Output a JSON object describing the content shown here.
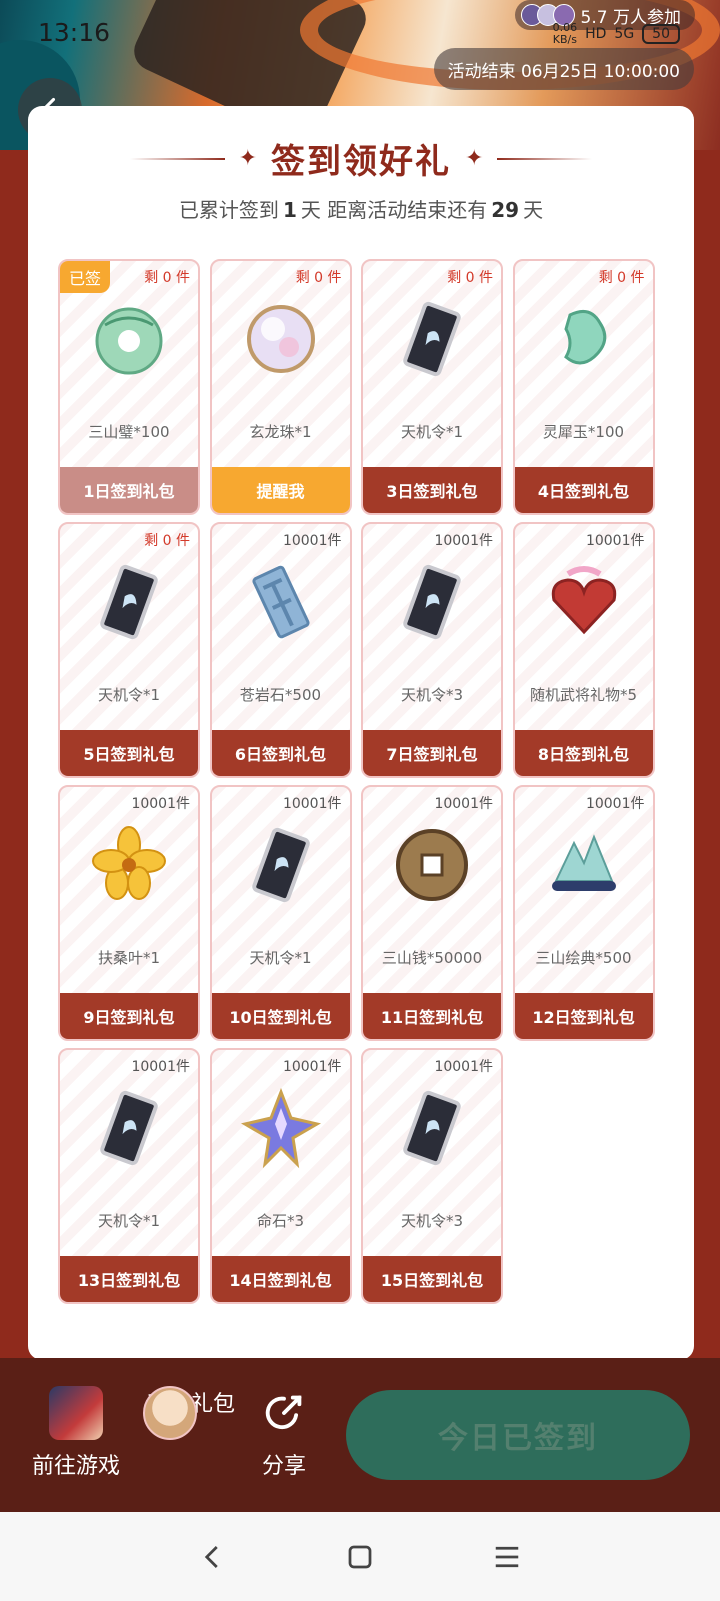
{
  "status_bar": {
    "time": "13:16",
    "net_speed": "0.06",
    "net_unit": "KB/s",
    "hd": "HD",
    "signal": "5G",
    "battery": "50"
  },
  "header": {
    "participants": "5.7 万人参加",
    "end_time": "活动结束 06月25日 10:00:00"
  },
  "card": {
    "title": "签到领好礼",
    "summary_prefix": "已累计签到",
    "summary_days": "1",
    "summary_mid": "天  距离活动结束还有",
    "summary_remaining": "29",
    "summary_suffix": "天"
  },
  "gifts": [
    {
      "stock": "剩 0 件",
      "name": "三山璧*100",
      "button": "1日签到礼包",
      "badge": "已签",
      "state": "done",
      "icon": "jade-disc"
    },
    {
      "stock": "剩 0 件",
      "name": "玄龙珠*1",
      "button": "提醒我",
      "state": "remind",
      "icon": "orb"
    },
    {
      "stock": "剩 0 件",
      "name": "天机令*1",
      "button": "3日签到礼包",
      "state": "normal",
      "icon": "token"
    },
    {
      "stock": "剩 0 件",
      "name": "灵犀玉*100",
      "button": "4日签到礼包",
      "state": "normal",
      "icon": "jade-pendant"
    },
    {
      "stock": "剩 0 件",
      "name": "天机令*1",
      "button": "5日签到礼包",
      "state": "normal",
      "icon": "token"
    },
    {
      "stock": "10001件",
      "name": "苍岩石*500",
      "button": "6日签到礼包",
      "state": "normal",
      "icon": "stone"
    },
    {
      "stock": "10001件",
      "name": "天机令*3",
      "button": "7日签到礼包",
      "state": "normal",
      "icon": "token"
    },
    {
      "stock": "10001件",
      "name": "随机武将礼物*5",
      "button": "8日签到礼包",
      "state": "normal",
      "icon": "gift-box"
    },
    {
      "stock": "10001件",
      "name": "扶桑叶*1",
      "button": "9日签到礼包",
      "state": "normal",
      "icon": "flower"
    },
    {
      "stock": "10001件",
      "name": "天机令*1",
      "button": "10日签到礼包",
      "state": "normal",
      "icon": "token"
    },
    {
      "stock": "10001件",
      "name": "三山钱*50000",
      "button": "11日签到礼包",
      "state": "normal",
      "icon": "coin"
    },
    {
      "stock": "10001件",
      "name": "三山绘典*500",
      "button": "12日签到礼包",
      "state": "normal",
      "icon": "scroll"
    },
    {
      "stock": "10001件",
      "name": "天机令*1",
      "button": "13日签到礼包",
      "state": "normal",
      "icon": "token"
    },
    {
      "stock": "10001件",
      "name": "命石*3",
      "button": "14日签到礼包",
      "state": "normal",
      "icon": "crystal"
    },
    {
      "stock": "10001件",
      "name": "天机令*3",
      "button": "15日签到礼包",
      "state": "normal",
      "icon": "token"
    }
  ],
  "bottom_bar": {
    "go_game": "前往游戏",
    "my_gifts": "我的礼包",
    "share": "分享",
    "checkin": "今日已签到"
  }
}
